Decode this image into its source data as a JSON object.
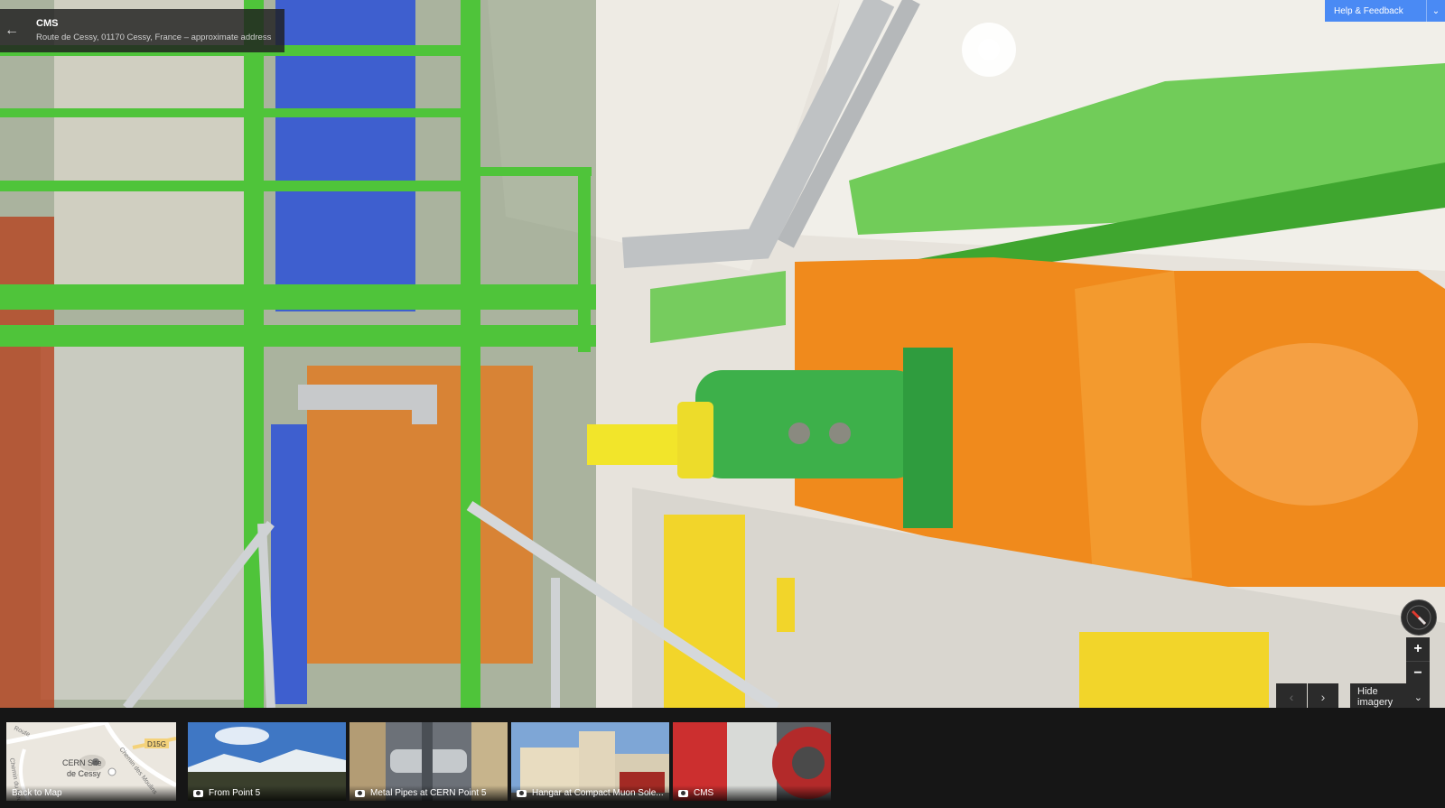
{
  "location": {
    "title": "CMS",
    "address": "Route de Cessy, 01170 Cessy, France – approximate address"
  },
  "header": {
    "help_label": "Help & Feedback",
    "help_icon": "chevron-down-icon"
  },
  "controls": {
    "zoom_in": "+",
    "zoom_out": "−",
    "prev": "‹",
    "next": "›",
    "hide_imagery": "Hide imagery",
    "hide_imagery_icon": "double-chevron-down-icon"
  },
  "minimap": {
    "label": "Back to Map",
    "place": "CERN Site de Cessy",
    "place_line1": "CERN Site",
    "place_line2": "de Cessy",
    "road_code": "D15G",
    "street1": "Chemin des Moulins",
    "street2": "Chemin du Moulin",
    "street3": "Route"
  },
  "thumbnails": [
    {
      "label": "From Point 5"
    },
    {
      "label": "Metal Pipes at CERN Point 5"
    },
    {
      "label": "Hangar at Compact Muon Sole..."
    },
    {
      "label": "CMS"
    }
  ],
  "colors": {
    "accent": "#4a8af4",
    "steel_green": "#4fc43a",
    "magnet_orange": "#f08a1c",
    "panel_blue": "#3e5fcf",
    "wall_yellow": "#f2d52a"
  }
}
